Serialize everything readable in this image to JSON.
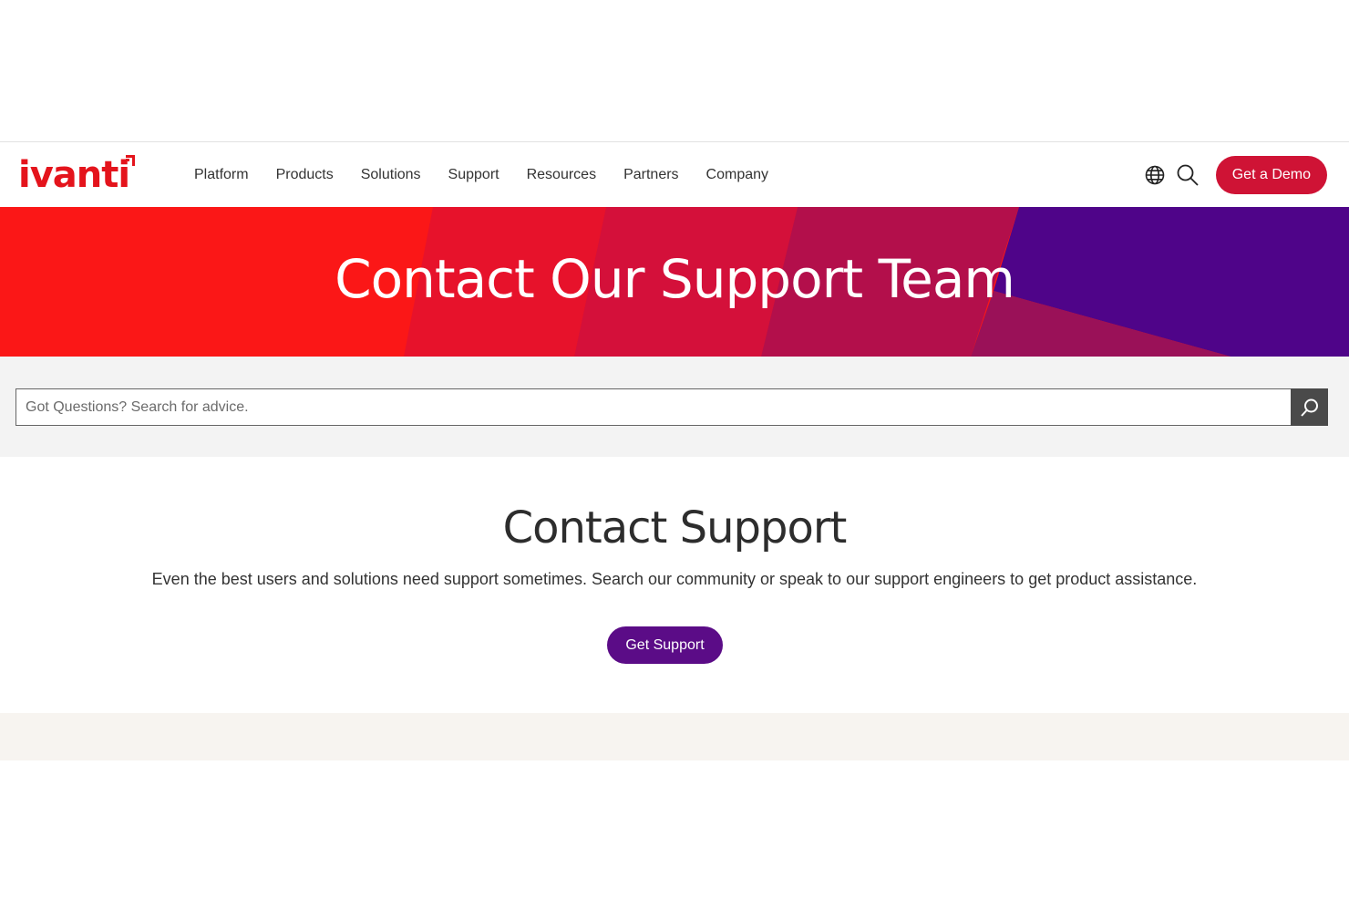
{
  "brand": {
    "logo_text": "ivanti",
    "accent_color": "#e4141c",
    "demo_color": "#cf1335",
    "support_color": "#5b0c87"
  },
  "nav": {
    "items": [
      {
        "label": "Platform"
      },
      {
        "label": "Products"
      },
      {
        "label": "Solutions"
      },
      {
        "label": "Support"
      },
      {
        "label": "Resources"
      },
      {
        "label": "Partners"
      },
      {
        "label": "Company"
      }
    ],
    "icons": [
      "globe-icon",
      "search-icon"
    ],
    "demo_label": "Get a Demo"
  },
  "hero": {
    "title": "Contact Our Support Team"
  },
  "search": {
    "placeholder": "Got Questions? Search for advice.",
    "value": ""
  },
  "contact": {
    "title": "Contact Support",
    "description": "Even the best users and solutions need support sometimes. Search our community or speak to our support engineers to get product assistance.",
    "button_label": "Get Support"
  }
}
